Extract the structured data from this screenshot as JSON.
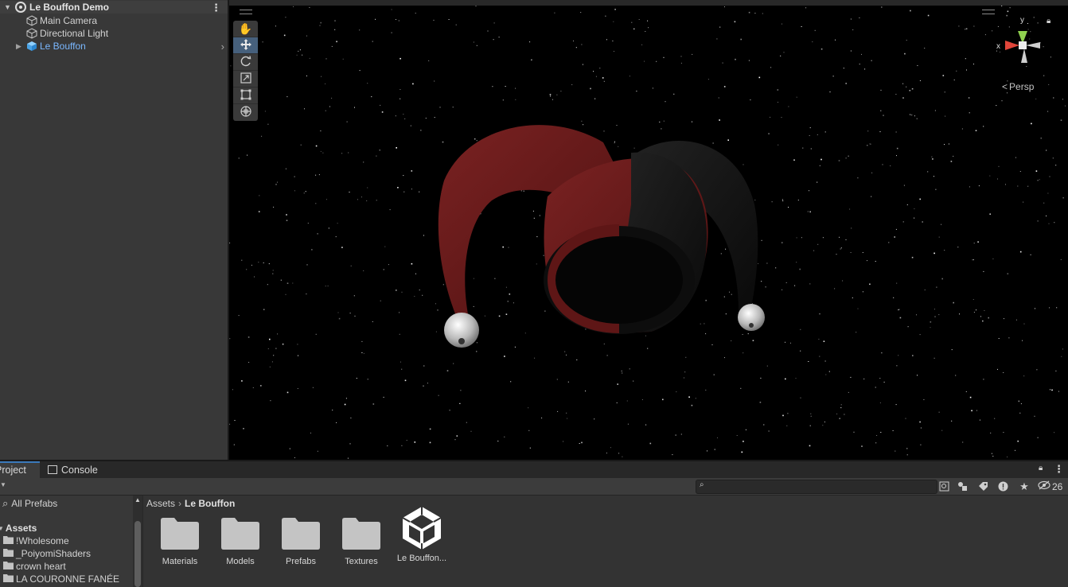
{
  "hierarchy": {
    "scene_name": "Le Bouffon Demo",
    "items": [
      {
        "label": "Main Camera"
      },
      {
        "label": "Directional Light"
      },
      {
        "label": "Le Bouffon",
        "selected_color": "#7ab7ff"
      }
    ]
  },
  "scene_view": {
    "camera_mode": "Persp",
    "gizmo_axes": {
      "x": "x",
      "y": "y"
    },
    "tools": [
      "hand-tool",
      "move-tool",
      "rotate-tool",
      "scale-tool",
      "rect-tool",
      "transform-tool"
    ],
    "active_tool": "move-tool"
  },
  "project_panel": {
    "tabs": [
      {
        "label": "Project"
      },
      {
        "label": "Console"
      }
    ],
    "hidden_count": "26",
    "tree": {
      "favorites": [
        {
          "label": "All Prefabs"
        }
      ],
      "root": "Assets",
      "folders": [
        {
          "label": "!Wholesome"
        },
        {
          "label": "_PoiyomiShaders"
        },
        {
          "label": "crown heart"
        },
        {
          "label": "LA COURONNE FANÉE"
        }
      ]
    },
    "breadcrumb": {
      "root": "Assets",
      "current": "Le Bouffon"
    },
    "assets": [
      {
        "label": "Materials",
        "type": "folder"
      },
      {
        "label": "Models",
        "type": "folder"
      },
      {
        "label": "Prefabs",
        "type": "folder"
      },
      {
        "label": "Textures",
        "type": "folder"
      },
      {
        "label": "Le Bouffon...",
        "type": "unity-scene"
      }
    ]
  },
  "colors": {
    "accent": "#3a79bb",
    "selected_text": "#7ab7ff",
    "hat_red": "#6e1a1a",
    "hat_black": "#131313"
  }
}
